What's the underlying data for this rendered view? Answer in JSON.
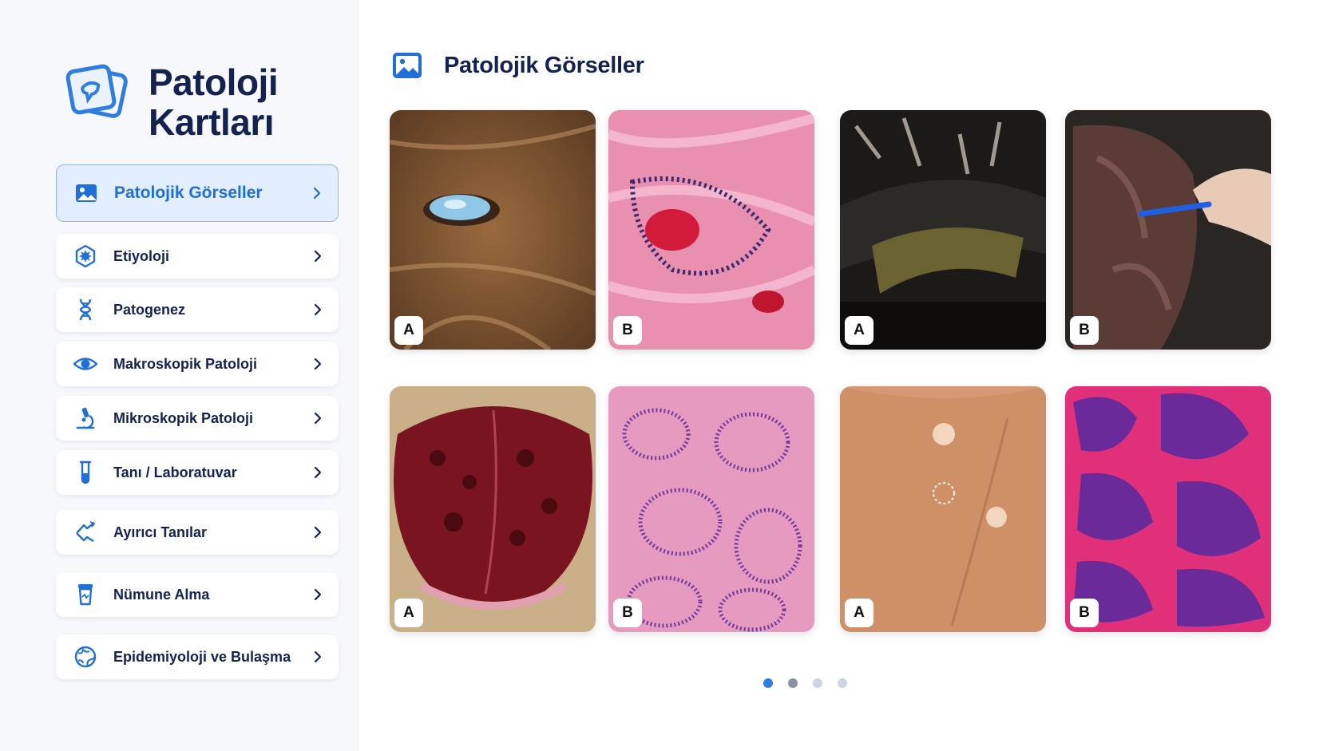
{
  "brand": {
    "line1": "Patoloji",
    "line2": "Kartları"
  },
  "menu": [
    {
      "label": "Patolojik Görseller",
      "icon": "image-icon"
    },
    {
      "label": "Etiyoloji",
      "icon": "virus-icon"
    },
    {
      "label": "Patogenez",
      "icon": "dna-icon"
    },
    {
      "label": "Makroskopik Patoloji",
      "icon": "eye-icon"
    },
    {
      "label": "Mikroskopik Patoloji",
      "icon": "microscope-icon"
    },
    {
      "label": "Tanı / Laboratuvar",
      "icon": "test-tube-icon"
    },
    {
      "label": "Ayırıcı Tanılar",
      "icon": "arrows-icon"
    },
    {
      "label": "Nümune Alma",
      "icon": "specimen-cup-icon"
    },
    {
      "label": "Epidemiyoloji ve Bulaşma",
      "icon": "globe-icon"
    }
  ],
  "main": {
    "title": "Patolojik Görseller",
    "images": [
      {
        "badge": "A",
        "icon": "eye-photo-icon"
      },
      {
        "badge": "B",
        "icon": "histology-photo-icon"
      },
      {
        "badge": "A",
        "icon": "necropsy-photo-icon"
      },
      {
        "badge": "B",
        "icon": "organ-probe-photo-icon"
      },
      {
        "badge": "A",
        "icon": "liver-photo-icon"
      },
      {
        "badge": "B",
        "icon": "histology-photo-icon"
      },
      {
        "badge": "A",
        "icon": "liver-photo-icon"
      },
      {
        "badge": "B",
        "icon": "histology-photo-icon"
      }
    ],
    "pagination": {
      "current": 1,
      "total": 4
    }
  },
  "colors": {
    "accent": "#1f6fd6",
    "navy": "#13224f",
    "active_bg": "#e3eefc"
  }
}
